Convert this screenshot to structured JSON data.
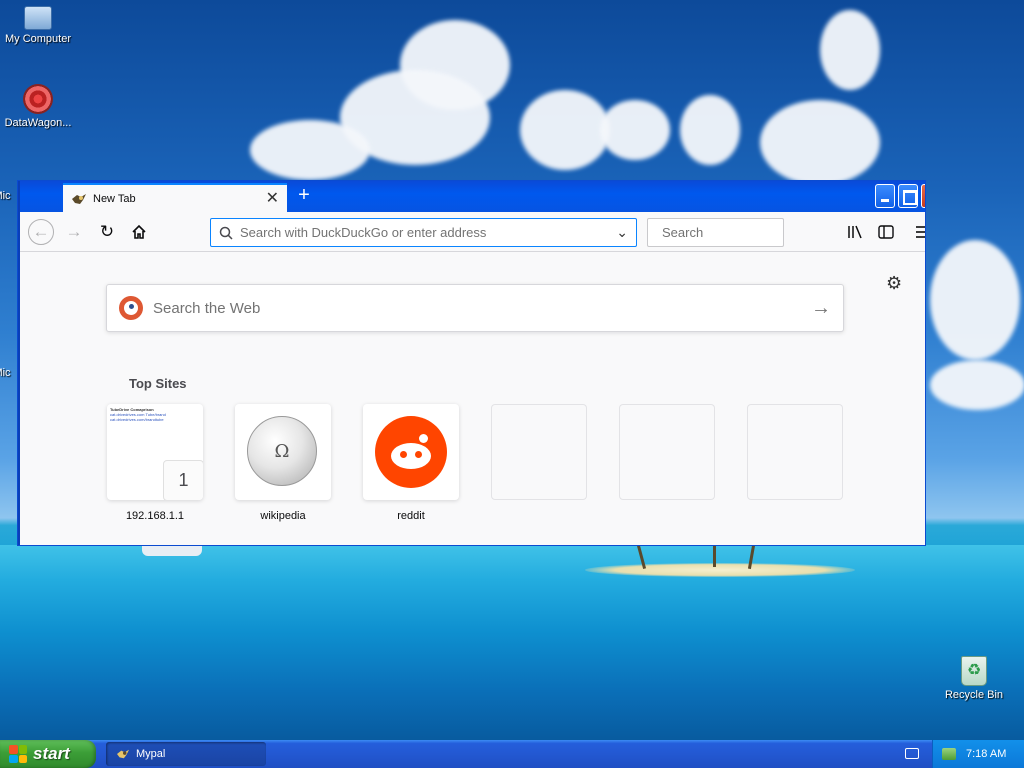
{
  "desktop": {
    "icons": [
      {
        "label": "My Computer"
      },
      {
        "label": "DataWagon..."
      },
      {
        "label": "Mic"
      },
      {
        "label": "Mic"
      },
      {
        "label": "Recycle Bin"
      }
    ]
  },
  "browser": {
    "tab": {
      "label": "New Tab"
    },
    "new_tab_symbol": "+",
    "toolbar": {
      "url_placeholder": "Search with DuckDuckGo or enter address",
      "search_placeholder": "Search"
    },
    "content": {
      "web_search_placeholder": "Search the Web",
      "top_sites_title": "Top Sites",
      "top_sites": [
        {
          "label": "192.168.1.1",
          "badge": "1",
          "thumb_header": "TubeDrive Comaprison",
          "thumb_lines": [
            "cat.drivedrives.com Tube/brand",
            "cat.drivedrives.com/brandtube"
          ]
        },
        {
          "label": "wikipedia"
        },
        {
          "label": "reddit"
        },
        {
          "label": ""
        },
        {
          "label": ""
        },
        {
          "label": ""
        }
      ]
    }
  },
  "taskbar": {
    "start_label": "start",
    "tasks": [
      {
        "label": "Mypal"
      }
    ],
    "clock": "7:18 AM"
  },
  "colors": {
    "accent": "#0a84ff",
    "xp_titlebar": "#0058ee",
    "start_green": "#3c9e37",
    "ddg_orange": "#de5833",
    "reddit_orange": "#ff4500"
  }
}
